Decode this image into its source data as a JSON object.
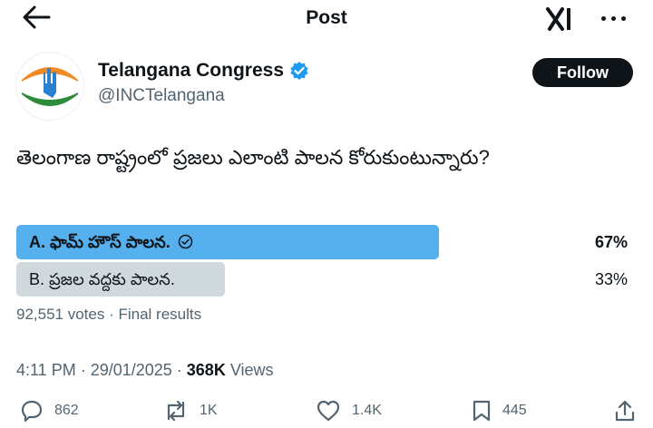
{
  "header": {
    "title": "Post"
  },
  "author": {
    "display_name": "Telangana Congress",
    "handle": "@INCTelangana",
    "follow_label": "Follow"
  },
  "post": {
    "text": "తెలంగాణ రాష్ట్రంలో ప్రజలు ఎలాంటి పాలన కోరుకుంటున్నారు?"
  },
  "poll": {
    "options": [
      {
        "label": "A. ఫామ్ హౌస్ పాలన.",
        "percent": "67%",
        "fraction": 0.67,
        "winner": true,
        "color": "#56b0ee"
      },
      {
        "label": "B. ప్రజల వద్దకు పాలన.",
        "percent": "33%",
        "fraction": 0.33,
        "winner": false,
        "color": "#cfd9de"
      }
    ],
    "summary": "92,551 votes · Final results"
  },
  "meta": {
    "time": "4:11 PM · 29/01/2025 · ",
    "views_count": "368K",
    "views_label": " Views"
  },
  "actions": {
    "replies": "862",
    "reposts": "1K",
    "likes": "1.4K",
    "bookmarks": "445"
  },
  "colors": {
    "accent_blue": "#1d9bf0",
    "poll_winner": "#56b0ee",
    "poll_other": "#cfd9de",
    "saffron": "#f08a24",
    "green": "#2e8b3a"
  },
  "icons": [
    "back-arrow-icon",
    "x-logo-icon",
    "more-icon",
    "verified-badge-icon",
    "check-circle-icon",
    "reply-icon",
    "repost-icon",
    "like-icon",
    "bookmark-icon",
    "share-icon"
  ]
}
